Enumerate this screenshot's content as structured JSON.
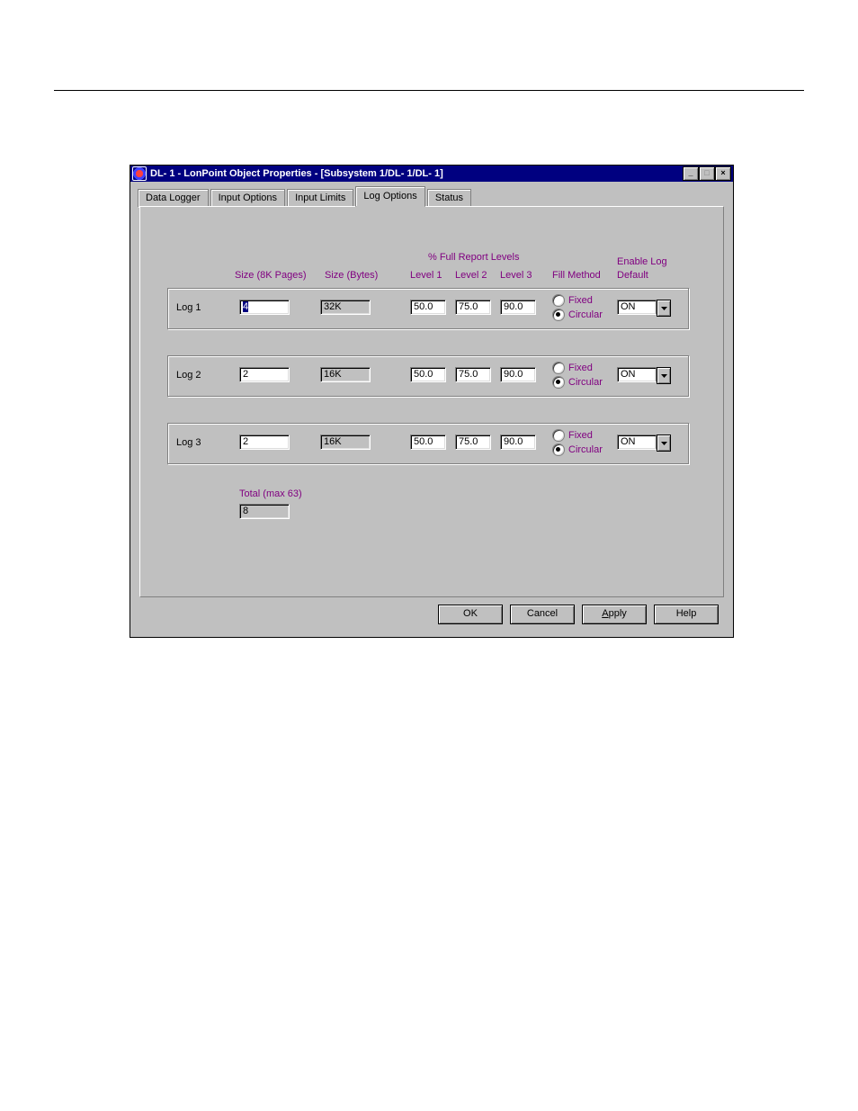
{
  "window": {
    "title": "DL- 1 - LonPoint Object Properties - [Subsystem 1/DL- 1/DL- 1]"
  },
  "tabs": [
    {
      "label": "Data Logger",
      "active": false
    },
    {
      "label": "Input Options",
      "active": false
    },
    {
      "label": "Input Limits",
      "active": false
    },
    {
      "label": "Log Options",
      "active": true
    },
    {
      "label": "Status",
      "active": false
    }
  ],
  "headers": {
    "size_pages": "Size (8K Pages)",
    "size_bytes": "Size (Bytes)",
    "full_report": "% Full Report Levels",
    "level1": "Level 1",
    "level2": "Level 2",
    "level3": "Level 3",
    "fill_method": "Fill Method",
    "enable_log": "Enable Log",
    "default": "Default"
  },
  "logs": [
    {
      "name": "Log 1",
      "size_pages": "4",
      "size_bytes": "32K",
      "level1": "50.0",
      "level2": "75.0",
      "level3": "90.0",
      "fill_fixed": "Fixed",
      "fill_circular": "Circular",
      "fill_selected": "circular",
      "enable": "ON"
    },
    {
      "name": "Log 2",
      "size_pages": "2",
      "size_bytes": "16K",
      "level1": "50.0",
      "level2": "75.0",
      "level3": "90.0",
      "fill_fixed": "Fixed",
      "fill_circular": "Circular",
      "fill_selected": "circular",
      "enable": "ON"
    },
    {
      "name": "Log 3",
      "size_pages": "2",
      "size_bytes": "16K",
      "level1": "50.0",
      "level2": "75.0",
      "level3": "90.0",
      "fill_fixed": "Fixed",
      "fill_circular": "Circular",
      "fill_selected": "circular",
      "enable": "ON"
    }
  ],
  "total": {
    "label": "Total (max 63)",
    "value": "8"
  },
  "buttons": {
    "ok": "OK",
    "cancel": "Cancel",
    "apply": "Apply",
    "help": "Help"
  }
}
